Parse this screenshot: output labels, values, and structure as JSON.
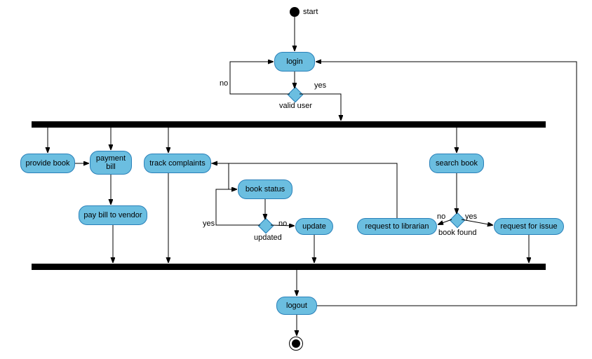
{
  "labels": {
    "start": "start",
    "login": "login",
    "valid_user": "valid user",
    "no1": "no",
    "yes1": "yes",
    "provide_book": "provide book",
    "payment_bill": "payment\nbill",
    "pay_bill_vendor": "pay bill to vendor",
    "track_complaints": "track complaints",
    "book_status": "book status",
    "update": "update",
    "updated": "updated",
    "yes2": "yes",
    "no2": "no",
    "search_book": "search book",
    "request_librarian": "request to librarian",
    "request_issue": "request for issue",
    "book_found": "book found",
    "no3": "no",
    "yes3": "yes",
    "logout": "logout"
  },
  "chart_data": {
    "type": "activity_diagram",
    "nodes": [
      {
        "id": "start",
        "type": "initial",
        "label": "start"
      },
      {
        "id": "login",
        "type": "action",
        "label": "login"
      },
      {
        "id": "valid_user",
        "type": "decision",
        "label": "valid user"
      },
      {
        "id": "fork1",
        "type": "fork"
      },
      {
        "id": "provide_book",
        "type": "action",
        "label": "provide book"
      },
      {
        "id": "payment_bill",
        "type": "action",
        "label": "payment bill"
      },
      {
        "id": "pay_bill_vendor",
        "type": "action",
        "label": "pay bill to vendor"
      },
      {
        "id": "track_complaints",
        "type": "action",
        "label": "track complaints"
      },
      {
        "id": "book_status",
        "type": "action",
        "label": "book status"
      },
      {
        "id": "updated",
        "type": "decision",
        "label": "updated"
      },
      {
        "id": "update",
        "type": "action",
        "label": "update"
      },
      {
        "id": "search_book",
        "type": "action",
        "label": "search book"
      },
      {
        "id": "book_found",
        "type": "decision",
        "label": "book found"
      },
      {
        "id": "request_librarian",
        "type": "action",
        "label": "request to librarian"
      },
      {
        "id": "request_issue",
        "type": "action",
        "label": "request for issue"
      },
      {
        "id": "join1",
        "type": "join"
      },
      {
        "id": "logout",
        "type": "action",
        "label": "logout"
      },
      {
        "id": "end",
        "type": "final"
      }
    ],
    "edges": [
      {
        "from": "start",
        "to": "login"
      },
      {
        "from": "login",
        "to": "valid_user"
      },
      {
        "from": "valid_user",
        "to": "login",
        "label": "no"
      },
      {
        "from": "valid_user",
        "to": "fork1",
        "label": "yes"
      },
      {
        "from": "fork1",
        "to": "provide_book"
      },
      {
        "from": "fork1",
        "to": "payment_bill"
      },
      {
        "from": "fork1",
        "to": "track_complaints"
      },
      {
        "from": "fork1",
        "to": "search_book"
      },
      {
        "from": "provide_book",
        "to": "payment_bill"
      },
      {
        "from": "payment_bill",
        "to": "pay_bill_vendor"
      },
      {
        "from": "pay_bill_vendor",
        "to": "join1"
      },
      {
        "from": "track_complaints",
        "to": "book_status"
      },
      {
        "from": "track_complaints",
        "to": "join1"
      },
      {
        "from": "book_status",
        "to": "updated"
      },
      {
        "from": "updated",
        "to": "book_status",
        "label": "yes"
      },
      {
        "from": "updated",
        "to": "update",
        "label": "no"
      },
      {
        "from": "update",
        "to": "join1"
      },
      {
        "from": "search_book",
        "to": "book_found"
      },
      {
        "from": "book_found",
        "to": "request_librarian",
        "label": "no"
      },
      {
        "from": "book_found",
        "to": "request_issue",
        "label": "yes"
      },
      {
        "from": "request_librarian",
        "to": "track_complaints"
      },
      {
        "from": "request_issue",
        "to": "join1"
      },
      {
        "from": "join1",
        "to": "logout"
      },
      {
        "from": "logout",
        "to": "end"
      },
      {
        "from": "logout",
        "to": "login"
      }
    ]
  }
}
